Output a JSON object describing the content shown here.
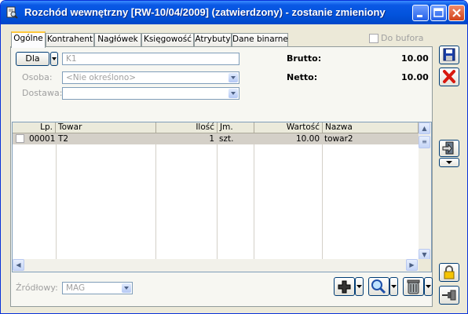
{
  "window": {
    "title": "Rozchód wewnętrzny [RW-10/04/2009] (zatwierdzony) - zostanie zmieniony"
  },
  "tabs": [
    {
      "label": "Ogólne",
      "active": true
    },
    {
      "label": "Kontrahent"
    },
    {
      "label": "Nagłówek"
    },
    {
      "label": "Księgowość"
    },
    {
      "label": "Atrybuty"
    },
    {
      "label": "Dane binarne"
    }
  ],
  "do_bufora": {
    "label": "Do bufora",
    "checked": false
  },
  "form": {
    "dla_button": "Dla",
    "dla_value": "K1",
    "osoba_label": "Osoba:",
    "osoba_value": "<Nie określono>",
    "dostawa_label": "Dostawa:",
    "dostawa_value": "",
    "brutto_label": "Brutto:",
    "brutto_value": "10.00",
    "netto_label": "Netto:",
    "netto_value": "10.00"
  },
  "table": {
    "columns": [
      "Lp.",
      "Towar",
      "Ilość",
      "Jm.",
      "Wartość",
      "Nazwa"
    ],
    "rows": [
      {
        "lp": "00001",
        "towar": "T2",
        "ilosc": "1",
        "jm": "szt.",
        "wartosc": "10.00",
        "nazwa": "towar2",
        "checked": false
      }
    ]
  },
  "footer": {
    "zrodlowy_label": "Źródłowy:",
    "zrodlowy_value": "MAG"
  },
  "icons": {
    "save": "floppy-disk-icon",
    "cancel": "red-x-icon",
    "side": "document-transfer-icon",
    "lock": "padlock-icon",
    "pin": "pin-icon",
    "add": "plus-icon",
    "search": "magnifier-icon",
    "trash": "trash-can-icon"
  },
  "colors": {
    "titlebar": "#0253DC",
    "window_bg": "#ECE9D8",
    "selected_row": "#D4D0C8",
    "tab_highlight": "#FFC83C",
    "cancel_red": "#D8190F",
    "save_blue": "#1B3FA8"
  }
}
